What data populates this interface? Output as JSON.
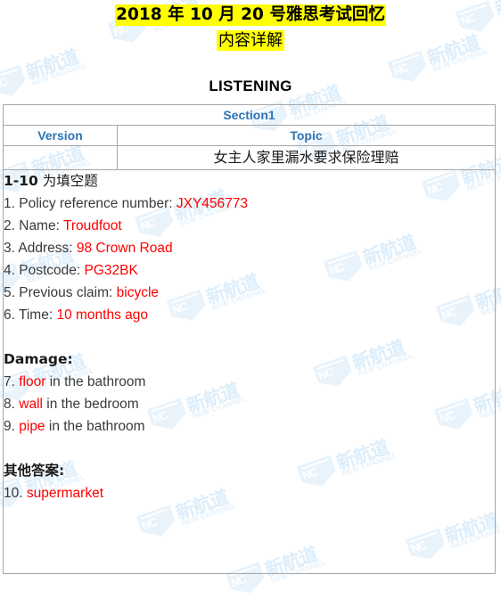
{
  "document": {
    "title": "2018 年 10 月 20 号雅思考试回忆",
    "subtitle": "内容详解",
    "section_heading": "LISTENING"
  },
  "watermark": {
    "logo_cn": "新航道",
    "logo_en": "NEW CHANNEL",
    "logo_mark": "NC",
    "color": "#e8f3fc"
  },
  "table": {
    "section_label": "Section1",
    "col_version": "Version",
    "col_topic": "Topic",
    "version_value": "",
    "topic_value": "女主人家里漏水要求保险理赔"
  },
  "colors": {
    "highlight": "#ffff00",
    "header_blue": "#2e74b5",
    "answer_red": "#ff0000",
    "border": "#a6a6a6"
  },
  "body": {
    "question_range_bold": "1-10",
    "question_range_rest": " 为填空题",
    "damage_label": "Damage:",
    "other_label": "其他答案:",
    "items": [
      {
        "num": "1.",
        "prompt": " Policy reference number: ",
        "answer": "JXY456773",
        "tail": ""
      },
      {
        "num": "2.",
        "prompt": " Name: ",
        "answer": "Troudfoot",
        "tail": ""
      },
      {
        "num": "3.",
        "prompt": " Address: ",
        "answer": "98 Crown Road",
        "tail": ""
      },
      {
        "num": "4.",
        "prompt": " Postcode: ",
        "answer": "PG32BK",
        "tail": ""
      },
      {
        "num": "5.",
        "prompt": " Previous claim: ",
        "answer": "bicycle",
        "tail": ""
      },
      {
        "num": "6.",
        "prompt": " Time: ",
        "answer": "10 months ago",
        "tail": ""
      }
    ],
    "damage_items": [
      {
        "num": "7.",
        "prompt": " ",
        "answer": "floor",
        "tail": " in the bathroom"
      },
      {
        "num": "8.",
        "prompt": " ",
        "answer": "wall",
        "tail": " in the bedroom"
      },
      {
        "num": "9.",
        "prompt": " ",
        "answer": "pipe",
        "tail": " in the bathroom"
      }
    ],
    "other_items": [
      {
        "num": "10.",
        "prompt": " ",
        "answer": "supermarket",
        "tail": ""
      }
    ]
  }
}
